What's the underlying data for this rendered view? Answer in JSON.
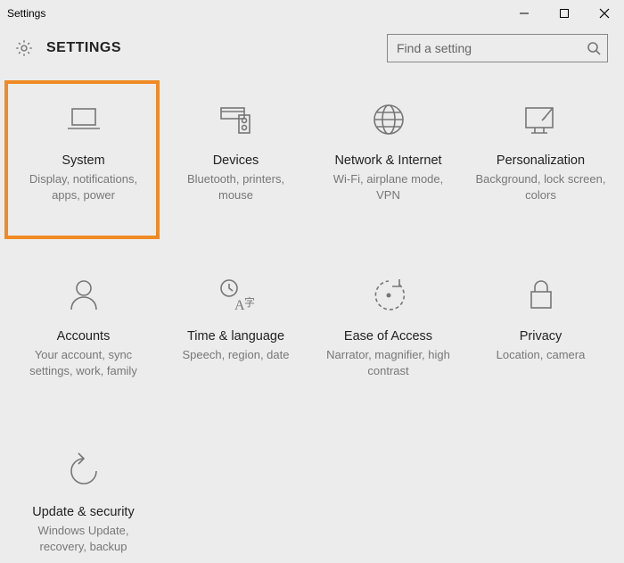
{
  "window": {
    "title": "Settings"
  },
  "header": {
    "title": "SETTINGS"
  },
  "search": {
    "placeholder": "Find a setting"
  },
  "tiles": [
    {
      "title": "System",
      "sub": "Display, notifications, apps, power"
    },
    {
      "title": "Devices",
      "sub": "Bluetooth, printers, mouse"
    },
    {
      "title": "Network & Internet",
      "sub": "Wi-Fi, airplane mode, VPN"
    },
    {
      "title": "Personalization",
      "sub": "Background, lock screen, colors"
    },
    {
      "title": "Accounts",
      "sub": "Your account, sync settings, work, family"
    },
    {
      "title": "Time & language",
      "sub": "Speech, region, date"
    },
    {
      "title": "Ease of Access",
      "sub": "Narrator, magnifier, high contrast"
    },
    {
      "title": "Privacy",
      "sub": "Location, camera"
    },
    {
      "title": "Update & security",
      "sub": "Windows Update, recovery, backup"
    }
  ]
}
